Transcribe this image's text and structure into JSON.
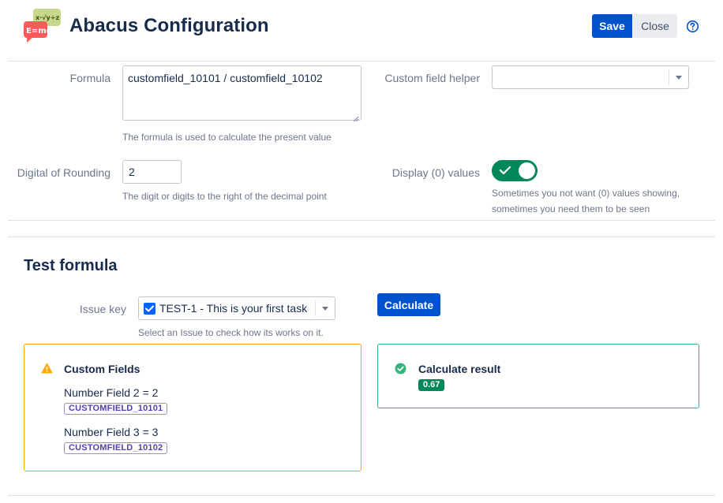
{
  "header": {
    "title": "Abacus Configuration",
    "save_label": "Save",
    "close_label": "Close",
    "help_icon": "question-circle-icon",
    "logo_text": "E=mc²",
    "logo_formula": "x·√y÷z"
  },
  "config": {
    "formula_label": "Formula",
    "formula_value": "customfield_10101 / customfield_10102",
    "formula_hint": "The formula is used to calculate the present value",
    "helper_label": "Custom field helper",
    "helper_value": "",
    "rounding_label": "Digital of Rounding",
    "rounding_value": "2",
    "rounding_hint": "The digit or digits to the right of the decimal point",
    "display_zero_label": "Display (0) values",
    "display_zero_enabled": true,
    "display_zero_hint_1": "Sometimes you not want (0) values showing,",
    "display_zero_hint_2": "sometimes you need them to be seen"
  },
  "test": {
    "title": "Test formula",
    "issue_key_label": "Issue key",
    "issue_value": "TEST-1 - This is your first task",
    "issue_hint": "Select an Issue to check how its works on it.",
    "calculate_label": "Calculate"
  },
  "custom_fields_panel": {
    "title": "Custom Fields",
    "fields": [
      {
        "text": "Number Field 2 = 2",
        "key": "CUSTOMFIELD_10101"
      },
      {
        "text": "Number Field 3 = 3",
        "key": "CUSTOMFIELD_10102"
      }
    ]
  },
  "result_panel": {
    "title": "Calculate result",
    "value": "0.67"
  },
  "colors": {
    "primary": "#0052cc",
    "success": "#00875a",
    "warning": "#ffab00",
    "text": "#172b4d",
    "subtle": "#6b778c"
  }
}
